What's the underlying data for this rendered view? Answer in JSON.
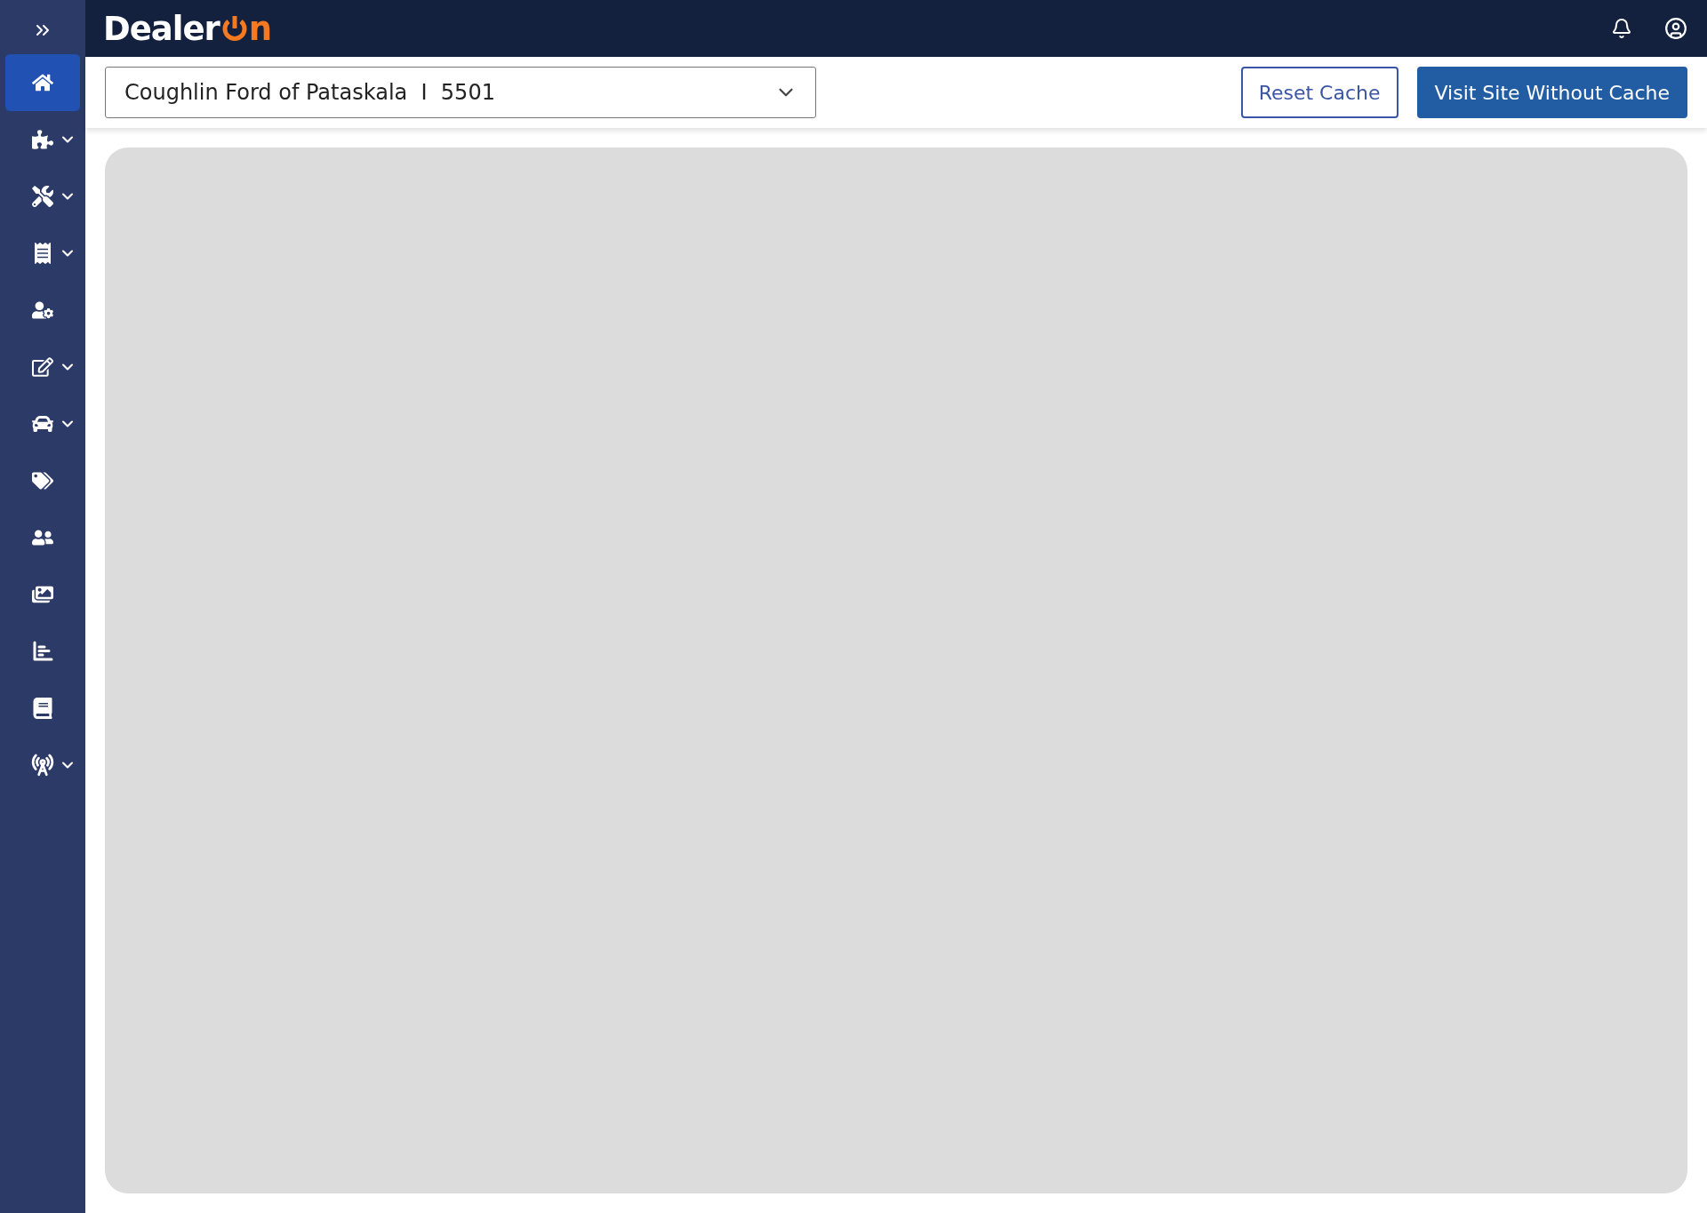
{
  "logo": {
    "text": "Dealer",
    "suffix": "n"
  },
  "sidebar": {
    "items": [
      {
        "selected": true,
        "expandable": false
      },
      {
        "selected": false,
        "expandable": true
      },
      {
        "selected": false,
        "expandable": true
      },
      {
        "selected": false,
        "expandable": true
      },
      {
        "selected": false,
        "expandable": false
      },
      {
        "selected": false,
        "expandable": true
      },
      {
        "selected": false,
        "expandable": true
      },
      {
        "selected": false,
        "expandable": false
      },
      {
        "selected": false,
        "expandable": false
      },
      {
        "selected": false,
        "expandable": false
      },
      {
        "selected": false,
        "expandable": false
      },
      {
        "selected": false,
        "expandable": false
      },
      {
        "selected": false,
        "expandable": true
      }
    ]
  },
  "toolbar": {
    "site_select": {
      "value": "Coughlin Ford of Pataskala  I  5501"
    },
    "buttons": [
      {
        "label": "Reset Cache",
        "kind": "outline"
      },
      {
        "label": "Visit Site Without Cache",
        "kind": "primary"
      }
    ]
  }
}
